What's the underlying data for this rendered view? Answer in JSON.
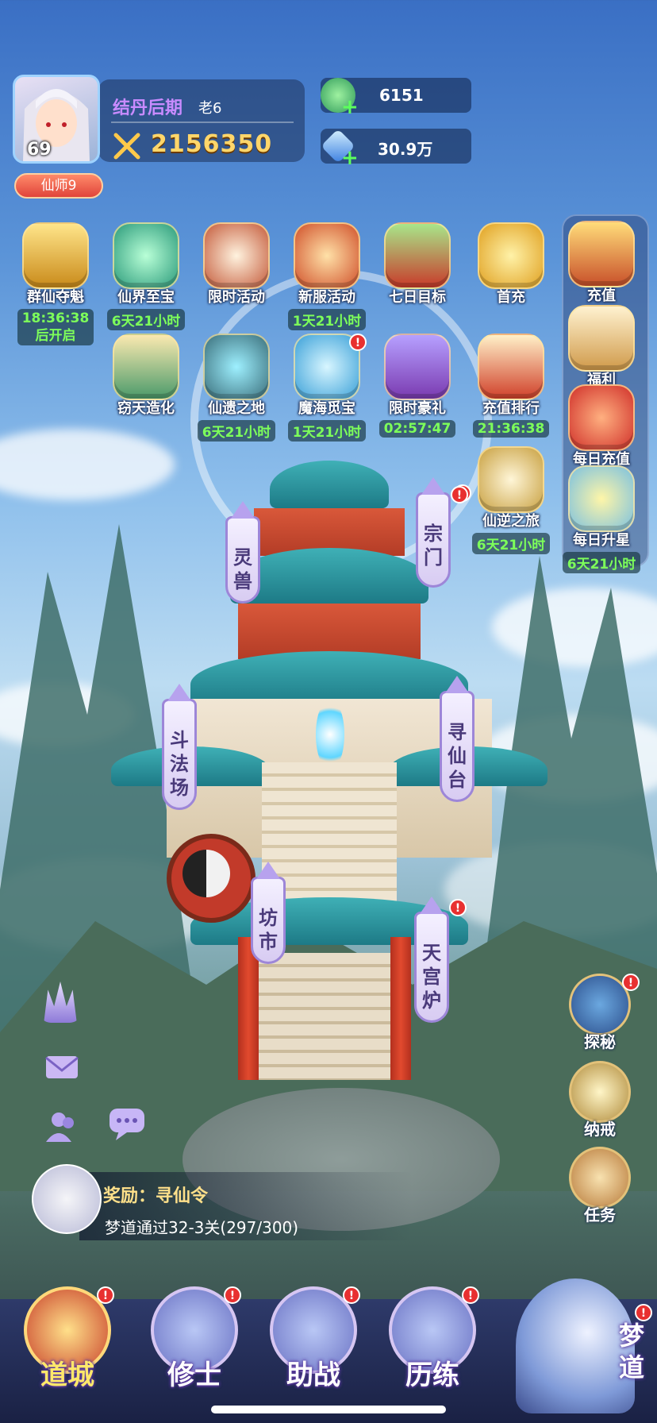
{
  "player": {
    "level": "69",
    "realm": "结丹后期",
    "server": "老6",
    "power": "2156350",
    "title_badge": "仙师9"
  },
  "resources": [
    {
      "icon": "jade-coin-icon",
      "value": "6151"
    },
    {
      "icon": "crystal-icon",
      "value": "30.9万"
    }
  ],
  "activities_row1": [
    {
      "name": "群仙夺魁",
      "icon": "golden-crown-icon",
      "timer": "18:36:38\n后开启",
      "badge": false
    },
    {
      "name": "仙界至宝",
      "icon": "jade-orb-icon",
      "timer": "6天21小时",
      "badge": false
    },
    {
      "name": "限时活动",
      "icon": "drum-icon",
      "timer": "",
      "badge": false
    },
    {
      "name": "新服活动",
      "icon": "phoenix-lantern-icon",
      "timer": "1天21小时",
      "badge": false
    },
    {
      "name": "七日目标",
      "icon": "seven-chest-icon",
      "timer": "",
      "badge": false
    },
    {
      "name": "首充",
      "icon": "treasure-bowl-icon",
      "timer": "",
      "badge": false
    }
  ],
  "activities_row2": [
    {
      "name": "窃天造化",
      "icon": "mountain-icon",
      "timer": "",
      "badge": false
    },
    {
      "name": "仙遗之地",
      "icon": "rune-stone-icon",
      "timer": "6天21小时",
      "badge": false
    },
    {
      "name": "魔海觅宝",
      "icon": "sea-dragon-icon",
      "timer": "1天21小时",
      "badge": true
    },
    {
      "name": "限时豪礼",
      "icon": "gift-box-icon",
      "timer": "02:57:47",
      "badge": false
    },
    {
      "name": "充值排行",
      "icon": "ranking-board-icon",
      "timer": "21:36:38",
      "badge": false
    }
  ],
  "activity_xiani": {
    "name": "仙逆之旅",
    "timer": "6天21小时",
    "icon": "crossed-swords-icon",
    "badge": true
  },
  "right_column": [
    {
      "name": "充值",
      "icon": "treasure-chest-icon"
    },
    {
      "name": "福利",
      "icon": "welfare-box-icon"
    },
    {
      "name": "每日充值",
      "icon": "lucky-bag-icon"
    },
    {
      "name": "每日升星",
      "icon": "star-badge-icon",
      "timer": "6天21小时"
    }
  ],
  "buildings": {
    "lingshou": "灵兽",
    "zongmen": "宗门",
    "doufachang": "斗法场",
    "xunxiantai": "寻仙台",
    "fangshi": "坊市",
    "tiangonglu": "天宫炉"
  },
  "right_buttons": [
    {
      "name": "探秘",
      "icon": "compass-icon",
      "badge": true
    },
    {
      "name": "纳戒",
      "icon": "storage-ring-icon",
      "badge": false
    },
    {
      "name": "任务",
      "icon": "quest-scroll-icon",
      "badge": false
    }
  ],
  "quest": {
    "reward": "奖励：寻仙令",
    "desc": "梦道通过32-3关(297/300)"
  },
  "nav": [
    {
      "label": "道城",
      "icon": "city-gate-icon",
      "badge": true
    },
    {
      "label": "修士",
      "icon": "cultivator-icon",
      "badge": true
    },
    {
      "label": "助战",
      "icon": "swords-icon",
      "badge": true
    },
    {
      "label": "历练",
      "icon": "mountain-trial-icon",
      "badge": true
    },
    {
      "label": "梦道",
      "icon": "dragon-hero-icon",
      "badge": true
    }
  ],
  "badge_mark": "!",
  "colors": {
    "timer": "#7dff5a",
    "realm": "#c88bff",
    "power": "#ffd66a",
    "badge": "#e83030"
  }
}
